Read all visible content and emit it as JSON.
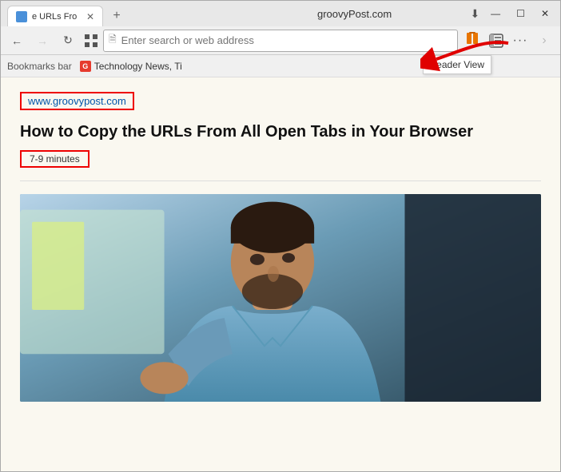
{
  "browser": {
    "title": "groovyPost.com",
    "tab": {
      "title": "e URLs Fro",
      "favicon_color": "#4a90d9"
    },
    "new_tab_label": "+",
    "window_controls": {
      "minimize": "—",
      "maximize": "☐",
      "close": "✕"
    }
  },
  "toolbar": {
    "back_label": "←",
    "forward_label": "→",
    "refresh_label": "↻",
    "home_label": "⌂",
    "address_placeholder": "Enter search or web address",
    "grid_icon": "⊞",
    "page_icon": "🗎",
    "reader_view_tooltip": "Reader View",
    "sidebar_icon": "▣",
    "more_icon": "···",
    "fwd_icon": "→"
  },
  "bookmarks_bar": {
    "label": "Bookmarks bar",
    "items": [
      {
        "label": "Technology News, Ti",
        "favicon_letter": "G",
        "favicon_color": "#e63b2e"
      }
    ]
  },
  "page": {
    "site_url": "www.groovypost.com",
    "article_title": "How to Copy the URLs From All Open Tabs in Your Browser",
    "reading_time": "7-9 minutes"
  }
}
